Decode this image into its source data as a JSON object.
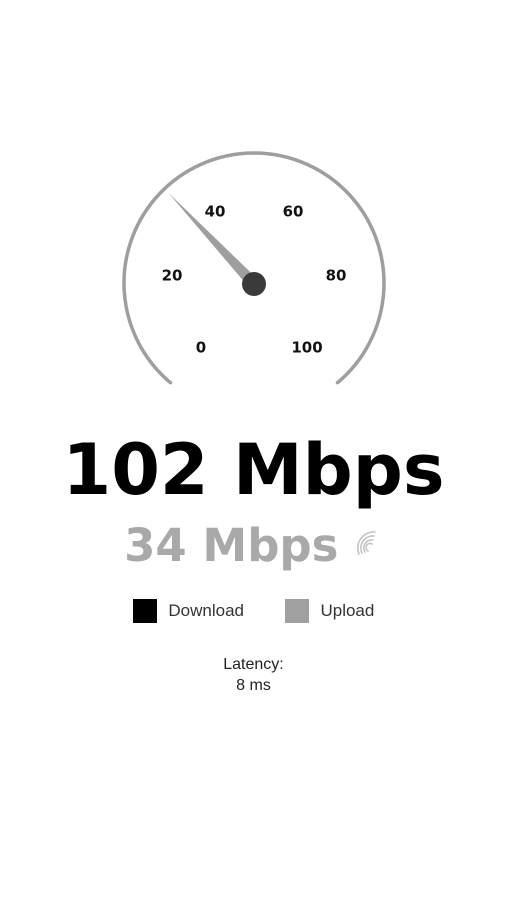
{
  "gauge": {
    "min": 0,
    "max": 100,
    "value": 34,
    "ticks": [
      "0",
      "20",
      "40",
      "60",
      "80",
      "100"
    ],
    "arc_color": "#9e9e9e",
    "needle_color": "#9e9e9e",
    "hub_color": "#3a3a3a"
  },
  "speeds": {
    "download": "102 Mbps",
    "upload": "34 Mbps",
    "upload_color": "#a9a9a9"
  },
  "status_icon": "loading-spinner-icon",
  "legend": {
    "download_label": "Download",
    "download_color": "#000000",
    "upload_label": "Upload",
    "upload_color": "#a0a0a0"
  },
  "latency": {
    "label": "Latency:",
    "value": "8 ms"
  }
}
